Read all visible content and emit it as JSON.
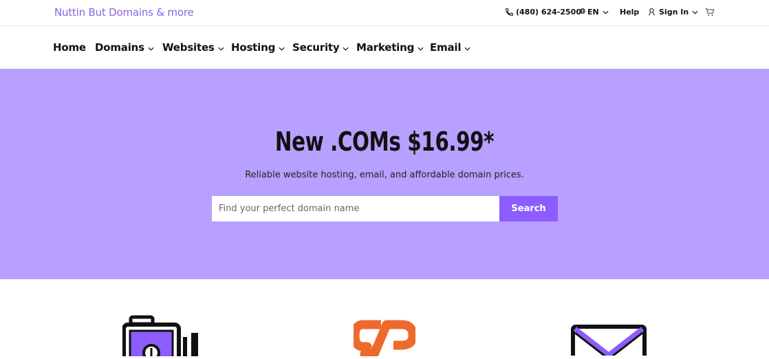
{
  "brand": {
    "name": "Nuttin But Domains & more",
    "color": "#8a63e8"
  },
  "utility": {
    "phone_icon": "phone-icon",
    "phone": "(480) 624-2500",
    "language_icon": "globe-icon",
    "language": "EN",
    "help": "Help",
    "signin_icon": "user-icon",
    "signin": "Sign In",
    "cart_icon": "cart-icon"
  },
  "nav": {
    "items": [
      {
        "label": "Home",
        "has_dropdown": false
      },
      {
        "label": "Domains",
        "has_dropdown": true
      },
      {
        "label": "Websites",
        "has_dropdown": true
      },
      {
        "label": "Hosting",
        "has_dropdown": true
      },
      {
        "label": "Security",
        "has_dropdown": true
      },
      {
        "label": "Marketing",
        "has_dropdown": true
      },
      {
        "label": "Email",
        "has_dropdown": true
      }
    ]
  },
  "hero": {
    "title": "New .COMs $16.99*",
    "subtitle": "Reliable website hosting, email, and affordable domain prices.",
    "search_placeholder": "Find your perfect domain name",
    "search_button": "Search",
    "background_color": "#b7a0ff",
    "button_color": "#8c5cff"
  },
  "features": {
    "icons": [
      "safe-icon",
      "cpanel-icon",
      "email-envelope-icon"
    ]
  }
}
